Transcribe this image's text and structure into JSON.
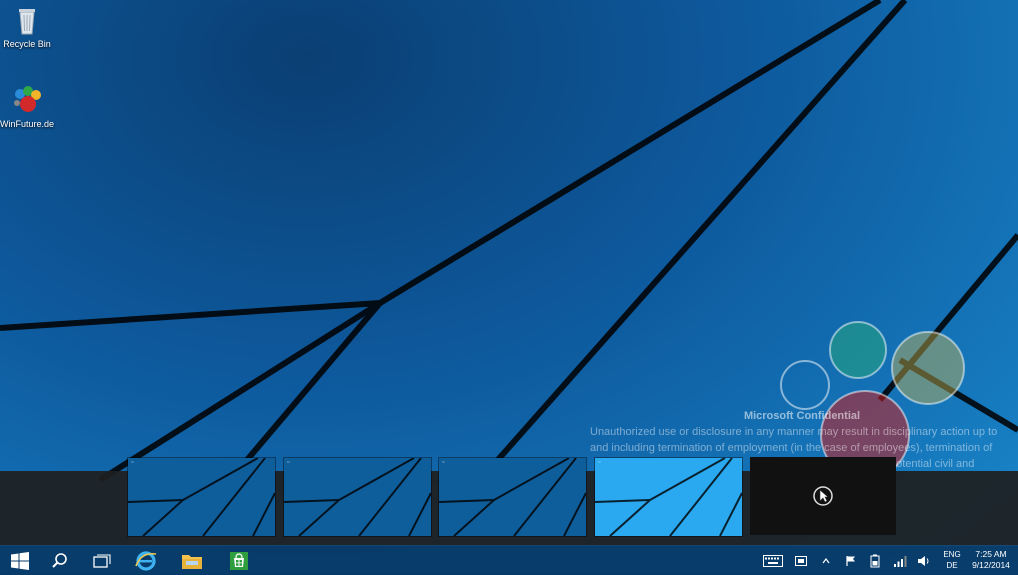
{
  "desktop": {
    "icons": [
      {
        "label": "Recycle Bin",
        "icon": "recycle-bin-icon"
      },
      {
        "label": "WinFuture.de",
        "icon": "winfuture-icon"
      }
    ],
    "confidential": {
      "title": "Microsoft Confidential",
      "line1": "Unauthorized use or disclosure in any manner may result in disciplinary action up to",
      "line2": "and including termination of employment (in the case of employees), termination of",
      "line3": "potential civil and"
    }
  },
  "task_switcher": {
    "windows": [
      {
        "label": "▫",
        "state": "inactive"
      },
      {
        "label": "▫",
        "state": "inactive"
      },
      {
        "label": "▫",
        "state": "inactive"
      },
      {
        "label": "▫",
        "state": "active"
      },
      {
        "label": "",
        "state": "empty"
      }
    ]
  },
  "taskbar": {
    "pinned": [
      "start-button",
      "search-button",
      "task-view-button",
      "internet-explorer",
      "file-explorer",
      "store"
    ],
    "tray": {
      "language_top": "ENG",
      "language_bottom": "DE",
      "time": "7:25 AM",
      "date": "9/12/2014"
    }
  },
  "colors": {
    "taskbar": "#083764",
    "accent": "#1e90d8",
    "active_thumb": "#2aa8f0"
  }
}
